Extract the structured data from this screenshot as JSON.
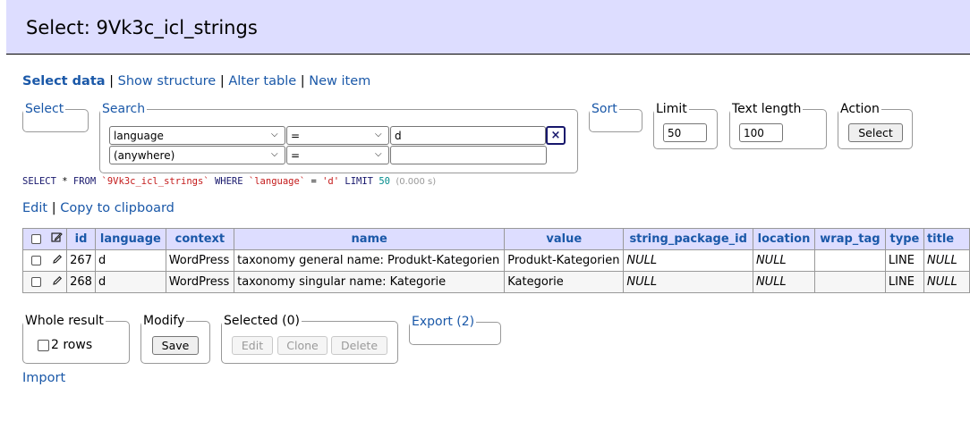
{
  "header": {
    "title": "Select: 9Vk3c_icl_strings"
  },
  "nav": {
    "current": "Select data",
    "sep": "|",
    "show_structure": "Show structure",
    "alter_table": "Alter table",
    "new_item": "New item"
  },
  "form": {
    "select_legend": "Select",
    "search_legend": "Search",
    "search_rows": [
      {
        "column": "language",
        "op": "=",
        "value": "d"
      },
      {
        "column": "(anywhere)",
        "op": "=",
        "value": ""
      }
    ],
    "remove_icon": "×",
    "sort_legend": "Sort",
    "limit_legend": "Limit",
    "limit_value": "50",
    "text_length_legend": "Text length",
    "text_length_value": "100",
    "action_legend": "Action",
    "action_button": "Select"
  },
  "sql": {
    "select": "SELECT",
    "star": " * ",
    "from": "FROM",
    "table": "`9Vk3c_icl_strings`",
    "where": "WHERE",
    "col": "`language`",
    "eq": " = ",
    "val": "'d'",
    "limit": "LIMIT",
    "limit_n": "50",
    "time": "(0.000 s)"
  },
  "edit_links": {
    "edit": "Edit",
    "sep": "|",
    "copy": "Copy to clipboard"
  },
  "table": {
    "columns": [
      "id",
      "language",
      "context",
      "name",
      "value",
      "string_package_id",
      "location",
      "wrap_tag",
      "type",
      "title"
    ],
    "rows": [
      {
        "id": "267",
        "language": "d",
        "context": "WordPress",
        "name": "taxonomy general name: Produkt-Kategorien",
        "value": "Produkt-Kategorien",
        "string_package_id": "NULL",
        "location": "NULL",
        "wrap_tag": "",
        "type": "LINE",
        "title": "NULL"
      },
      {
        "id": "268",
        "language": "d",
        "context": "WordPress",
        "name": "taxonomy singular name: Kategorie",
        "value": "Kategorie",
        "string_package_id": "NULL",
        "location": "NULL",
        "wrap_tag": "",
        "type": "LINE",
        "title": "NULL"
      }
    ]
  },
  "bottom": {
    "whole_result_legend": "Whole result",
    "rows_label": "2 rows",
    "modify_legend": "Modify",
    "save_button": "Save",
    "selected_legend": "Selected (0)",
    "edit_button": "Edit",
    "clone_button": "Clone",
    "delete_button": "Delete",
    "export_legend": "Export (2)"
  },
  "import_link": "Import"
}
